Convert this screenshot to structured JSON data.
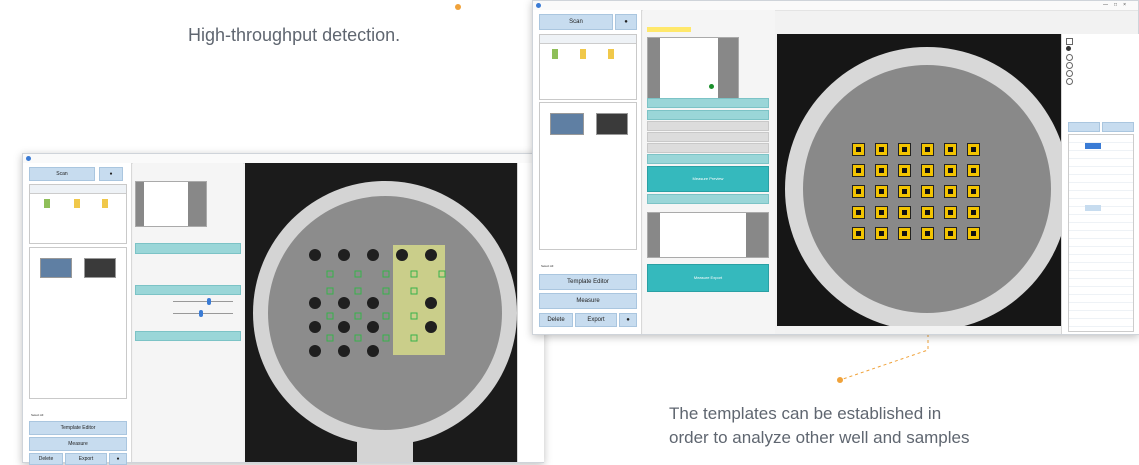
{
  "captions": {
    "top": "High-throughput detection.",
    "bottom_line1": "The templates can be established in",
    "bottom_line2": "order to analyze other well and samples"
  },
  "colors": {
    "accent_orange": "#f0a23a",
    "highlight_yellow": "#f3c400",
    "button_blue": "#c7dcef",
    "teal": "#35b9bd"
  },
  "left_window": {
    "scan": "Scan",
    "template_editor": "Template Editor",
    "measure": "Measure",
    "delete": "Delete",
    "export": "Export",
    "select_all": "Select All"
  },
  "right_window": {
    "scan": "Scan",
    "template_editor": "Template Editor",
    "measure": "Measure",
    "delete": "Delete",
    "export": "Export",
    "select_all": "Select All",
    "measure_preview": "Measure Preview",
    "measure_export": "Measure Export"
  }
}
